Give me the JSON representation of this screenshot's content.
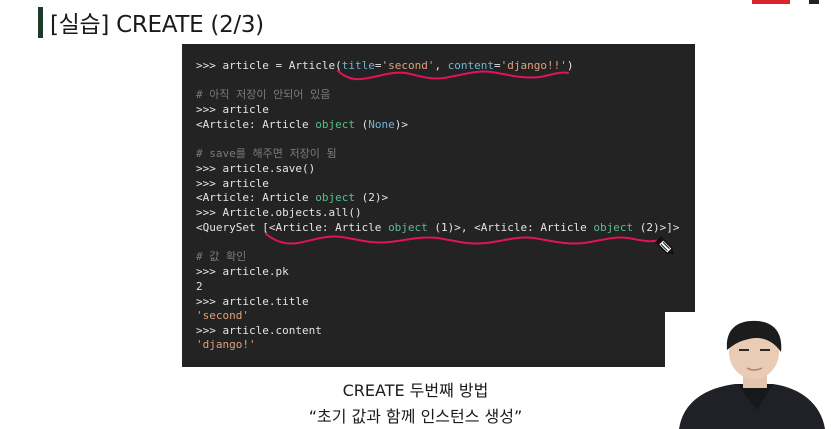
{
  "slide": {
    "title": "[실습] CREATE (2/3)",
    "caption_line1": "CREATE 두번째 방법",
    "caption_line2": "“초기 값과 함께 인스턴스 생성”"
  },
  "code": {
    "l1_prompt": ">>> article = Article(",
    "l1_kw1": "title",
    "l1_eq1": "=",
    "l1_str1": "'second'",
    "l1_comma": ", ",
    "l1_kw2": "content",
    "l1_eq2": "=",
    "l1_str2": "'django!!'",
    "l1_close": ")",
    "l2_comment": "# 아직 저장이 안되어 있음",
    "l3": ">>> article",
    "l4_a": "<Article: Article ",
    "l4_obj": "object",
    "l4_b": " (",
    "l4_none": "None",
    "l4_c": ")>",
    "l5_comment": "# save를 해주면 저장이 됨",
    "l6": ">>> article.save()",
    "l7": ">>> article",
    "l8_a": "<Article: Article ",
    "l8_obj": "object",
    "l8_b": " (2)>",
    "l9": ">>> Article.objects.all()",
    "l10_a": "<QuerySet [<Article: Article ",
    "l10_obj1": "object",
    "l10_b": " (1)>, <Article: Article ",
    "l10_obj2": "object",
    "l10_c": " (2)>]>",
    "l11_comment": "# 값 확인",
    "l12": ">>> article.pk",
    "l13": "2",
    "l14": ">>> article.title",
    "l15": "'second'",
    "l16": ">>> article.content",
    "l17": "'django!'"
  },
  "colors": {
    "panel_bg": "#232323",
    "annotation": "#e0145a",
    "accent_bar": "#1d3a2a"
  },
  "icons": {
    "pen_cursor": "highlighter-pen-icon"
  }
}
